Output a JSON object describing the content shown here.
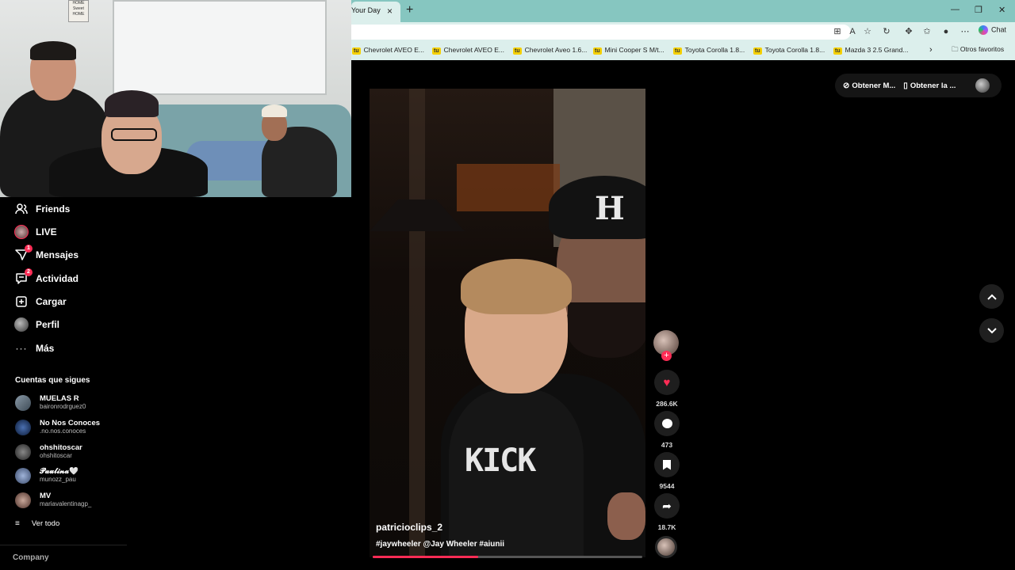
{
  "browser": {
    "tab_title": "Your Day",
    "tab_close": "×",
    "new_tab": "+",
    "chat_label": "Chat",
    "bookmarks": [
      {
        "icon": "tu",
        "label": "Chevrolet AVEO E..."
      },
      {
        "icon": "tu",
        "label": "Chevrolet AVEO E..."
      },
      {
        "icon": "tu",
        "label": "Chevrolet Aveo 1.6..."
      },
      {
        "icon": "tu",
        "label": "Mini Cooper S M/t..."
      },
      {
        "icon": "tu",
        "label": "Toyota Corolla 1.8..."
      },
      {
        "icon": "tu",
        "label": "Toyota Corolla 1.8..."
      },
      {
        "icon": "tu",
        "label": "Mazda 3 2.5 Grand..."
      }
    ],
    "other_bookmarks": "Otros favoritos"
  },
  "webcam": {
    "sign_text": "HOME Sweet HOME"
  },
  "sidebar": {
    "items": [
      {
        "label": "Friends",
        "icon": "friends-icon"
      },
      {
        "label": "LIVE",
        "icon": "live-icon"
      },
      {
        "label": "Mensajes",
        "icon": "messages-icon",
        "badge": "1"
      },
      {
        "label": "Actividad",
        "icon": "activity-icon",
        "badge": "2"
      },
      {
        "label": "Cargar",
        "icon": "upload-icon"
      },
      {
        "label": "Perfil",
        "icon": "profile-icon"
      },
      {
        "label": "Más",
        "icon": "more-icon"
      }
    ],
    "following_title": "Cuentas que sigues",
    "accounts": [
      {
        "name": "MUELAS R",
        "handle": "baironrodrguez0"
      },
      {
        "name": "No Nos Conoces",
        "handle": ".no.nos.conoces"
      },
      {
        "name": "ohshitoscar",
        "handle": "ohshitoscar"
      },
      {
        "name": "𝓟𝓪𝓾𝓵𝓲𝓷𝓪🤍",
        "handle": "munozz_pau"
      },
      {
        "name": "MV",
        "handle": "mariavalentinagp_"
      }
    ],
    "see_all": "Ver todo",
    "company": "Company"
  },
  "top_actions": {
    "get_coins": "Obtener M...",
    "get_app": "Obtener la ..."
  },
  "video": {
    "overlay_text": "KICK",
    "cap_logo": "H",
    "username": "patricioclips_2",
    "caption": "#jaywheeler @Jay Wheeler #aiunii",
    "progress": 0.39
  },
  "actions": {
    "likes": "286.6K",
    "comments": "473",
    "saves": "9544",
    "shares": "18.7K"
  },
  "colors": {
    "accent": "#fe2c55",
    "browser_frame": "#86c6c0",
    "toolbar": "#dcefec"
  }
}
